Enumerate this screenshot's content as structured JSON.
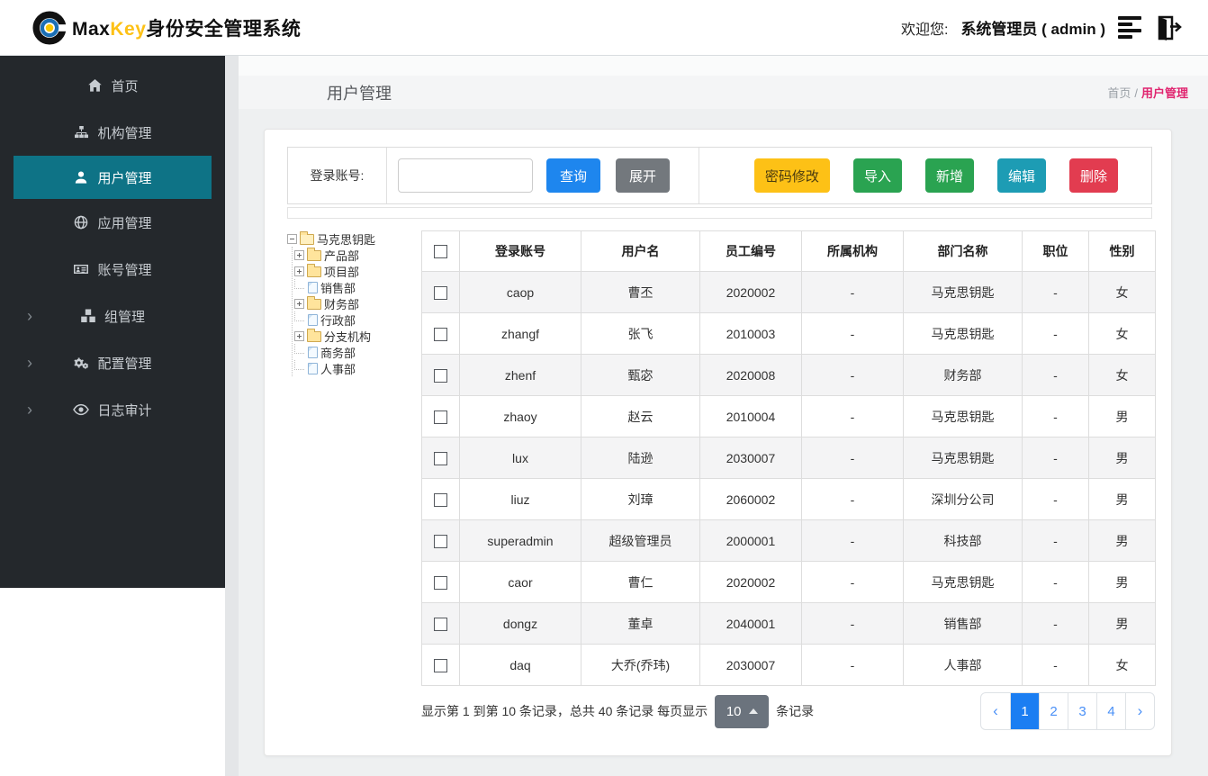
{
  "header": {
    "brand_max": "Max",
    "brand_key": "Key",
    "brand_suffix": "身份安全管理系统",
    "welcome_label": "欢迎您:",
    "user_label": "系统管理员 ( admin )"
  },
  "sidebar": {
    "items": [
      {
        "label": "首页",
        "icon": "home-icon",
        "active": false,
        "has_children": false
      },
      {
        "label": "机构管理",
        "icon": "sitemap-icon",
        "active": false,
        "has_children": false
      },
      {
        "label": "用户管理",
        "icon": "user-icon",
        "active": true,
        "has_children": false
      },
      {
        "label": "应用管理",
        "icon": "globe-icon",
        "active": false,
        "has_children": false
      },
      {
        "label": "账号管理",
        "icon": "id-card-icon",
        "active": false,
        "has_children": false
      },
      {
        "label": "组管理",
        "icon": "cubes-icon",
        "active": false,
        "has_children": true
      },
      {
        "label": "配置管理",
        "icon": "gears-icon",
        "active": false,
        "has_children": true
      },
      {
        "label": "日志审计",
        "icon": "eye-icon",
        "active": false,
        "has_children": true
      }
    ]
  },
  "page": {
    "title": "用户管理",
    "breadcrumb_home": "首页",
    "breadcrumb_sep": "/",
    "breadcrumb_current": "用户管理"
  },
  "search": {
    "label": "登录账号:",
    "input_value": "",
    "query_button": "查询",
    "expand_button": "展开",
    "actions": [
      {
        "label": "密码修改",
        "color": "#fdc116",
        "text_color": "#4a3b10"
      },
      {
        "label": "导入",
        "color": "#2aa351",
        "text_color": "#ffffff"
      },
      {
        "label": "新增",
        "color": "#2aa351",
        "text_color": "#ffffff"
      },
      {
        "label": "编辑",
        "color": "#1d9cb4",
        "text_color": "#ffffff"
      },
      {
        "label": "删除",
        "color": "#e23c50",
        "text_color": "#ffffff"
      }
    ]
  },
  "tree": {
    "root": "马克思钥匙",
    "children": [
      {
        "label": "产品部",
        "type": "folder"
      },
      {
        "label": "项目部",
        "type": "folder"
      },
      {
        "label": "销售部",
        "type": "leaf"
      },
      {
        "label": "财务部",
        "type": "folder"
      },
      {
        "label": "行政部",
        "type": "leaf"
      },
      {
        "label": "分支机构",
        "type": "folder"
      },
      {
        "label": "商务部",
        "type": "leaf"
      },
      {
        "label": "人事部",
        "type": "leaf"
      }
    ]
  },
  "table": {
    "columns": [
      "登录账号",
      "用户名",
      "员工编号",
      "所属机构",
      "部门名称",
      "职位",
      "性别"
    ],
    "rows": [
      [
        "caop",
        "曹丕",
        "2020002",
        "-",
        "马克思钥匙",
        "-",
        "女"
      ],
      [
        "zhangf",
        "张飞",
        "2010003",
        "-",
        "马克思钥匙",
        "-",
        "女"
      ],
      [
        "zhenf",
        "甄宓",
        "2020008",
        "-",
        "财务部",
        "-",
        "女"
      ],
      [
        "zhaoy",
        "赵云",
        "2010004",
        "-",
        "马克思钥匙",
        "-",
        "男"
      ],
      [
        "lux",
        "陆逊",
        "2030007",
        "-",
        "马克思钥匙",
        "-",
        "男"
      ],
      [
        "liuz",
        "刘璋",
        "2060002",
        "-",
        "深圳分公司",
        "-",
        "男"
      ],
      [
        "superadmin",
        "超级管理员",
        "2000001",
        "-",
        "科技部",
        "-",
        "男"
      ],
      [
        "caor",
        "曹仁",
        "2020002",
        "-",
        "马克思钥匙",
        "-",
        "男"
      ],
      [
        "dongz",
        "董卓",
        "2040001",
        "-",
        "销售部",
        "-",
        "男"
      ],
      [
        "daq",
        "大乔(乔玮)",
        "2030007",
        "-",
        "人事部",
        "-",
        "女"
      ]
    ]
  },
  "pagination": {
    "info_prefix": "显示第 1 到第 10 条记录，总共 40 条记录  每页显示",
    "page_size": "10",
    "info_suffix": "条记录",
    "prev": "‹",
    "next": "›",
    "pages": [
      "1",
      "2",
      "3",
      "4"
    ],
    "active_page": "1"
  },
  "colors": {
    "sidebar_active": "#0e7386",
    "breadcrumb_active": "#e0246f",
    "pagination_active": "#1b7ef2",
    "query_blue": "#1e86ee"
  }
}
